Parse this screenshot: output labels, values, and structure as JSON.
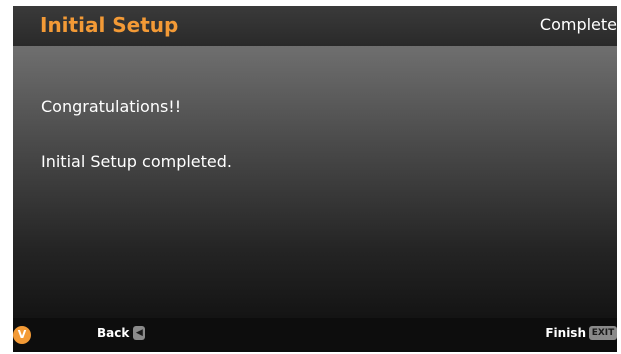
{
  "header": {
    "title": "Initial Setup",
    "step": "Complete"
  },
  "main": {
    "line1": "Congratulations!!",
    "line2": "Initial Setup completed."
  },
  "footer": {
    "logo_letter": "V",
    "back_label": "Back",
    "back_key": "◀",
    "finish_label": "Finish",
    "finish_key": "EXIT"
  },
  "colors": {
    "accent": "#f39a36",
    "text": "#ffffff"
  }
}
